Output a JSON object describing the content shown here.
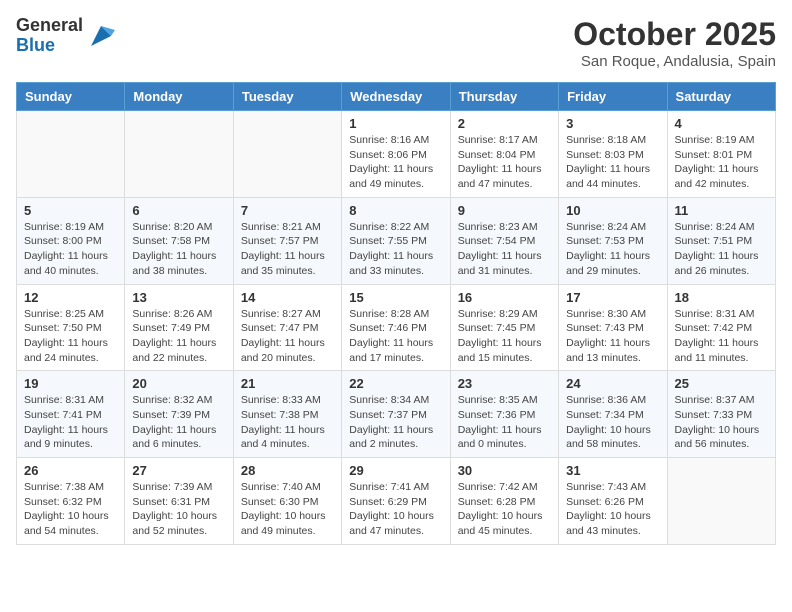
{
  "logo": {
    "general": "General",
    "blue": "Blue"
  },
  "title": "October 2025",
  "location": "San Roque, Andalusia, Spain",
  "weekdays": [
    "Sunday",
    "Monday",
    "Tuesday",
    "Wednesday",
    "Thursday",
    "Friday",
    "Saturday"
  ],
  "weeks": [
    [
      {
        "day": "",
        "info": ""
      },
      {
        "day": "",
        "info": ""
      },
      {
        "day": "",
        "info": ""
      },
      {
        "day": "1",
        "info": "Sunrise: 8:16 AM\nSunset: 8:06 PM\nDaylight: 11 hours and 49 minutes."
      },
      {
        "day": "2",
        "info": "Sunrise: 8:17 AM\nSunset: 8:04 PM\nDaylight: 11 hours and 47 minutes."
      },
      {
        "day": "3",
        "info": "Sunrise: 8:18 AM\nSunset: 8:03 PM\nDaylight: 11 hours and 44 minutes."
      },
      {
        "day": "4",
        "info": "Sunrise: 8:19 AM\nSunset: 8:01 PM\nDaylight: 11 hours and 42 minutes."
      }
    ],
    [
      {
        "day": "5",
        "info": "Sunrise: 8:19 AM\nSunset: 8:00 PM\nDaylight: 11 hours and 40 minutes."
      },
      {
        "day": "6",
        "info": "Sunrise: 8:20 AM\nSunset: 7:58 PM\nDaylight: 11 hours and 38 minutes."
      },
      {
        "day": "7",
        "info": "Sunrise: 8:21 AM\nSunset: 7:57 PM\nDaylight: 11 hours and 35 minutes."
      },
      {
        "day": "8",
        "info": "Sunrise: 8:22 AM\nSunset: 7:55 PM\nDaylight: 11 hours and 33 minutes."
      },
      {
        "day": "9",
        "info": "Sunrise: 8:23 AM\nSunset: 7:54 PM\nDaylight: 11 hours and 31 minutes."
      },
      {
        "day": "10",
        "info": "Sunrise: 8:24 AM\nSunset: 7:53 PM\nDaylight: 11 hours and 29 minutes."
      },
      {
        "day": "11",
        "info": "Sunrise: 8:24 AM\nSunset: 7:51 PM\nDaylight: 11 hours and 26 minutes."
      }
    ],
    [
      {
        "day": "12",
        "info": "Sunrise: 8:25 AM\nSunset: 7:50 PM\nDaylight: 11 hours and 24 minutes."
      },
      {
        "day": "13",
        "info": "Sunrise: 8:26 AM\nSunset: 7:49 PM\nDaylight: 11 hours and 22 minutes."
      },
      {
        "day": "14",
        "info": "Sunrise: 8:27 AM\nSunset: 7:47 PM\nDaylight: 11 hours and 20 minutes."
      },
      {
        "day": "15",
        "info": "Sunrise: 8:28 AM\nSunset: 7:46 PM\nDaylight: 11 hours and 17 minutes."
      },
      {
        "day": "16",
        "info": "Sunrise: 8:29 AM\nSunset: 7:45 PM\nDaylight: 11 hours and 15 minutes."
      },
      {
        "day": "17",
        "info": "Sunrise: 8:30 AM\nSunset: 7:43 PM\nDaylight: 11 hours and 13 minutes."
      },
      {
        "day": "18",
        "info": "Sunrise: 8:31 AM\nSunset: 7:42 PM\nDaylight: 11 hours and 11 minutes."
      }
    ],
    [
      {
        "day": "19",
        "info": "Sunrise: 8:31 AM\nSunset: 7:41 PM\nDaylight: 11 hours and 9 minutes."
      },
      {
        "day": "20",
        "info": "Sunrise: 8:32 AM\nSunset: 7:39 PM\nDaylight: 11 hours and 6 minutes."
      },
      {
        "day": "21",
        "info": "Sunrise: 8:33 AM\nSunset: 7:38 PM\nDaylight: 11 hours and 4 minutes."
      },
      {
        "day": "22",
        "info": "Sunrise: 8:34 AM\nSunset: 7:37 PM\nDaylight: 11 hours and 2 minutes."
      },
      {
        "day": "23",
        "info": "Sunrise: 8:35 AM\nSunset: 7:36 PM\nDaylight: 11 hours and 0 minutes."
      },
      {
        "day": "24",
        "info": "Sunrise: 8:36 AM\nSunset: 7:34 PM\nDaylight: 10 hours and 58 minutes."
      },
      {
        "day": "25",
        "info": "Sunrise: 8:37 AM\nSunset: 7:33 PM\nDaylight: 10 hours and 56 minutes."
      }
    ],
    [
      {
        "day": "26",
        "info": "Sunrise: 7:38 AM\nSunset: 6:32 PM\nDaylight: 10 hours and 54 minutes."
      },
      {
        "day": "27",
        "info": "Sunrise: 7:39 AM\nSunset: 6:31 PM\nDaylight: 10 hours and 52 minutes."
      },
      {
        "day": "28",
        "info": "Sunrise: 7:40 AM\nSunset: 6:30 PM\nDaylight: 10 hours and 49 minutes."
      },
      {
        "day": "29",
        "info": "Sunrise: 7:41 AM\nSunset: 6:29 PM\nDaylight: 10 hours and 47 minutes."
      },
      {
        "day": "30",
        "info": "Sunrise: 7:42 AM\nSunset: 6:28 PM\nDaylight: 10 hours and 45 minutes."
      },
      {
        "day": "31",
        "info": "Sunrise: 7:43 AM\nSunset: 6:26 PM\nDaylight: 10 hours and 43 minutes."
      },
      {
        "day": "",
        "info": ""
      }
    ]
  ]
}
